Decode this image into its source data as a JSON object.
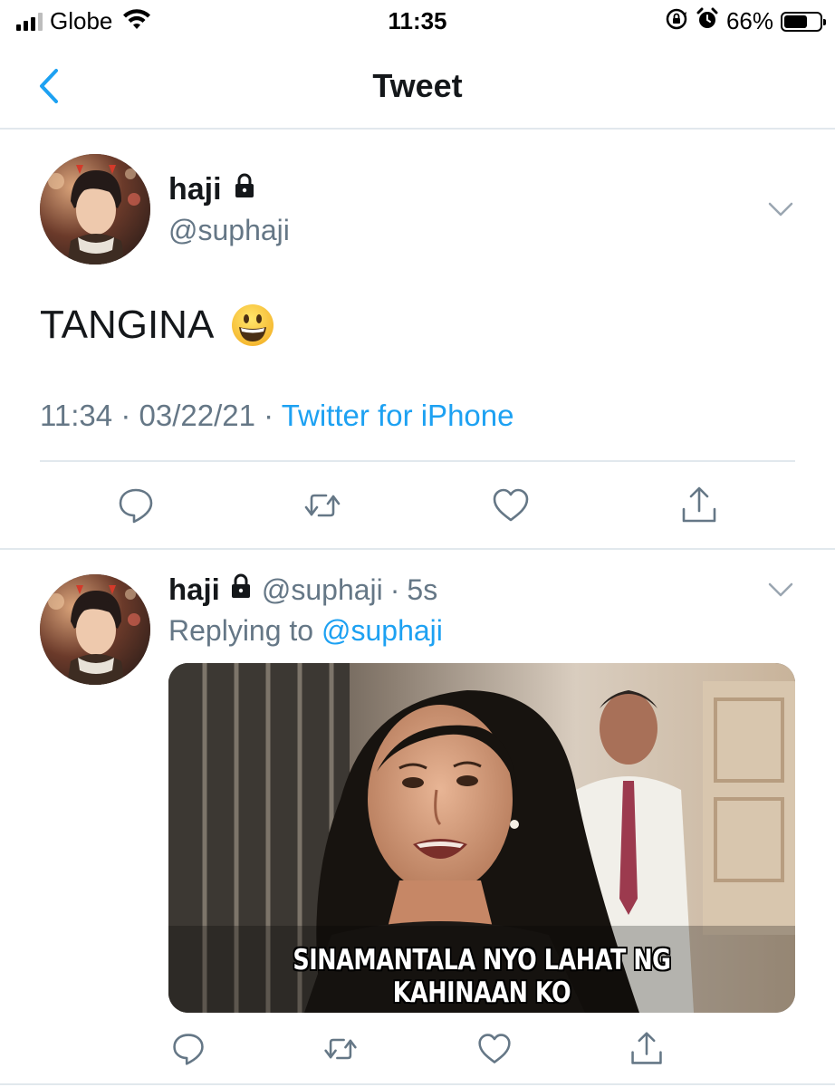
{
  "status_bar": {
    "carrier": "Globe",
    "time": "11:35",
    "battery_percent": "66%",
    "battery_level": 0.66,
    "signal_bars": 3,
    "icons": [
      "signal-icon",
      "wifi-icon",
      "rotation-lock-icon",
      "alarm-icon",
      "battery-icon"
    ]
  },
  "navbar": {
    "title": "Tweet",
    "back_icon": "chevron-left-icon"
  },
  "colors": {
    "accent": "#1da1f2",
    "secondary_text": "#657786",
    "divider": "#e1e8ed"
  },
  "main_tweet": {
    "display_name": "haji",
    "handle": "@suphaji",
    "protected_icon": "lock-icon",
    "text": "TANGINA",
    "emoji": "grinning-face-emoji",
    "time": "11:34",
    "separator": "·",
    "date": "03/22/21",
    "source": "Twitter for iPhone",
    "actions": [
      "reply-icon",
      "retweet-icon",
      "like-icon",
      "share-icon"
    ]
  },
  "reply_tweet": {
    "display_name": "haji",
    "handle": "@suphaji",
    "separator": "·",
    "time_ago": "5s",
    "replying_prefix": "Replying to",
    "replying_to": "@suphaji",
    "media_caption": "SINAMANTALA NYO LAHAT NG KAHINAAN KO",
    "actions": [
      "reply-icon",
      "retweet-icon",
      "like-icon",
      "share-icon"
    ]
  }
}
